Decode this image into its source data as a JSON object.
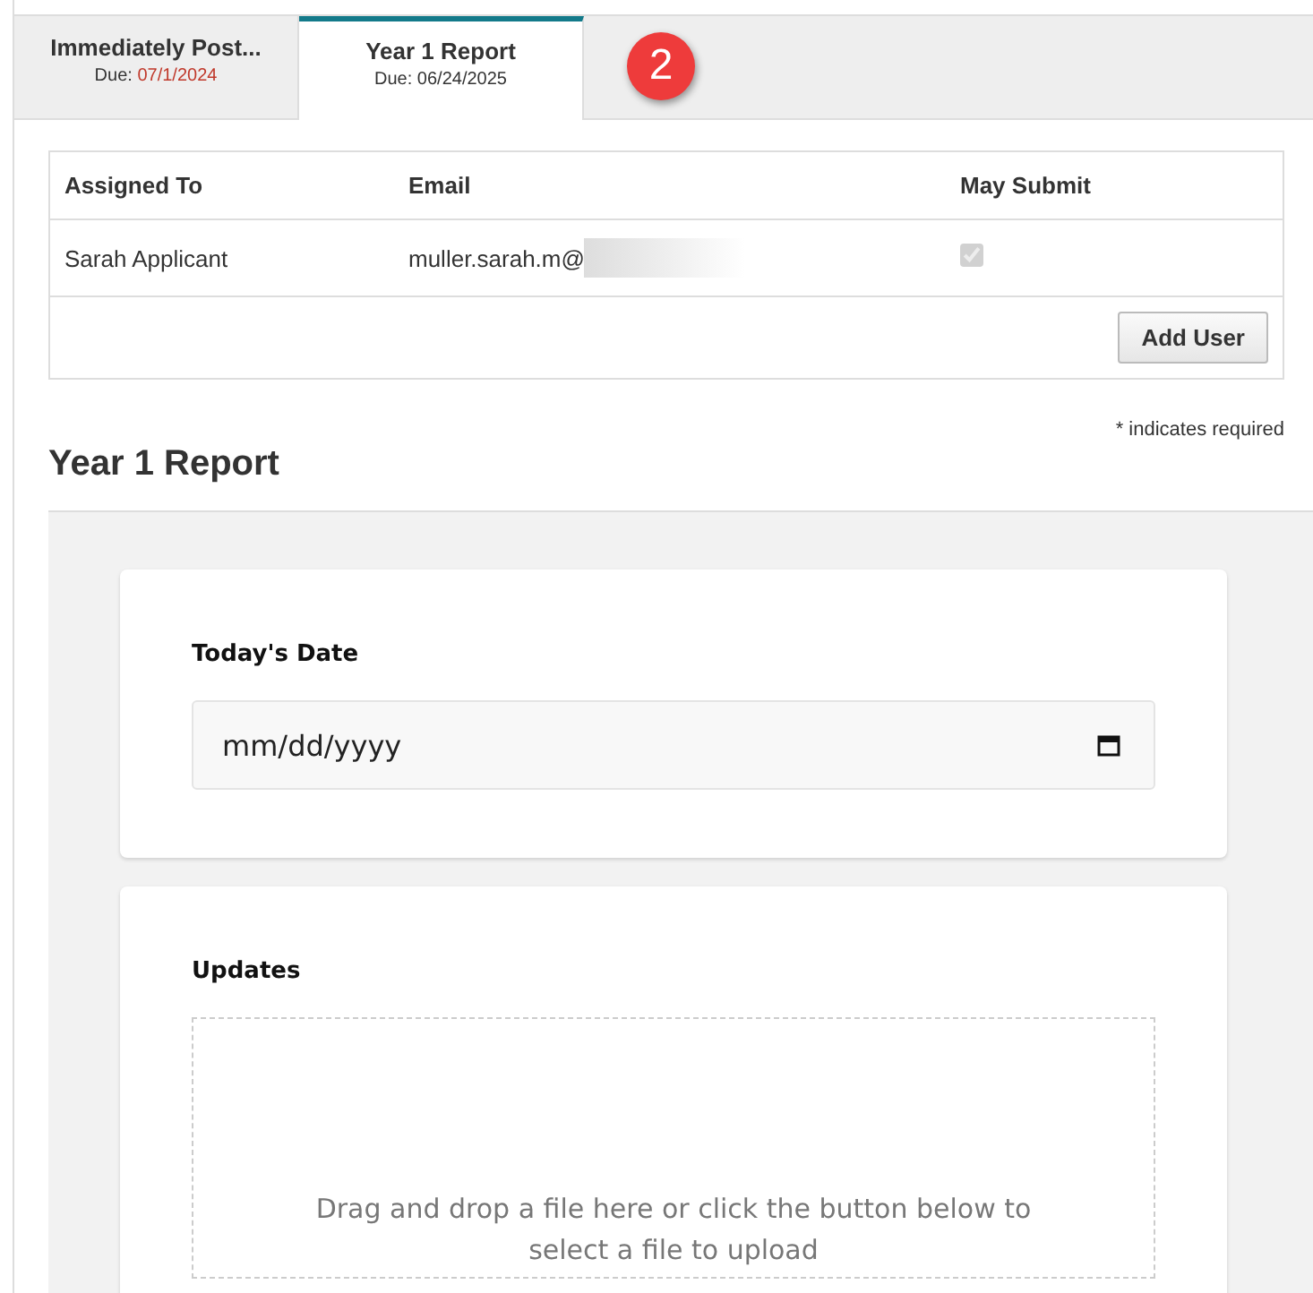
{
  "tabs": [
    {
      "title": "Immediately Post...",
      "due_label": "Due:",
      "due_date": "07/1/2024",
      "overdue": true,
      "selected": false
    },
    {
      "title": "Year 1 Report",
      "due_label": "Due:",
      "due_date": "06/24/2025",
      "overdue": false,
      "selected": true
    }
  ],
  "badge": "2",
  "assignees": {
    "columns": [
      "Assigned To",
      "Email",
      "May Submit"
    ],
    "rows": [
      {
        "name": "Sarah Applicant",
        "email": "muller.sarah.m@",
        "email_redacted": true,
        "may_submit": true,
        "disabled": true
      }
    ],
    "add_button": "Add User"
  },
  "required_note": "* indicates required",
  "section_title": "Year 1 Report",
  "fields": [
    {
      "kind": "date",
      "label": "Today's Date",
      "placeholder": "mm/dd/yyyy"
    },
    {
      "kind": "upload",
      "label": "Updates",
      "hint": "Drag and drop a file here or click the button below to select a file to upload"
    }
  ]
}
